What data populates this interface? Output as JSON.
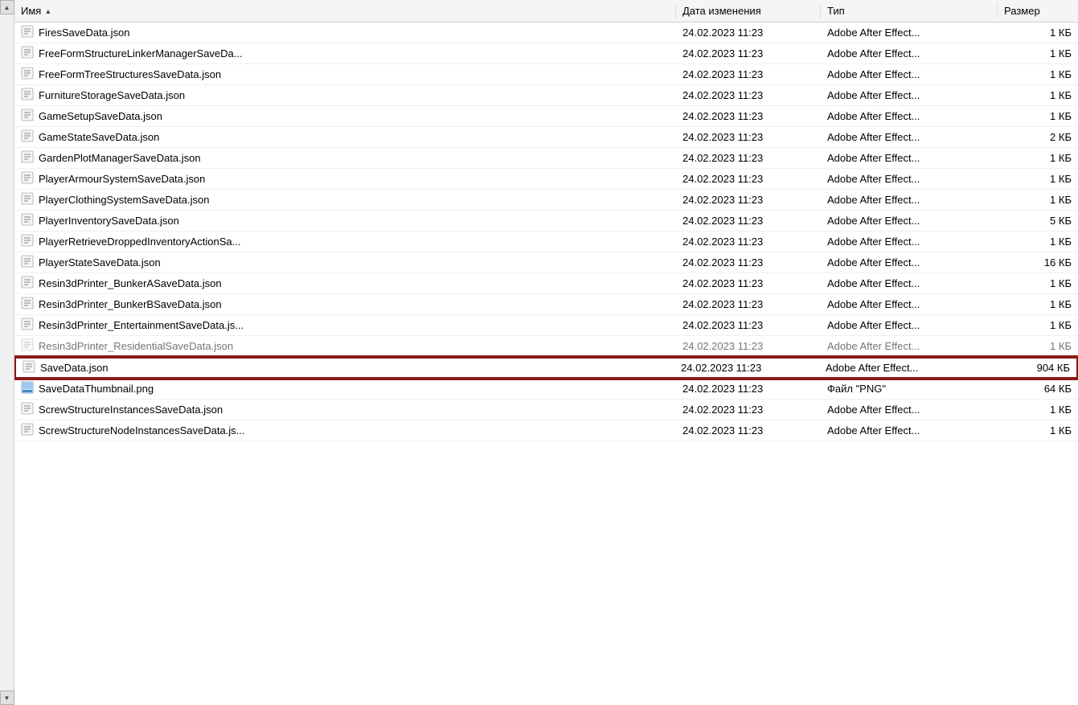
{
  "colors": {
    "selected_border": "#8b1a1a",
    "header_bg": "#f5f5f5",
    "row_hover": "#e8f0fe",
    "text": "#000000",
    "bg": "#ffffff"
  },
  "columns": [
    {
      "key": "name",
      "label": "Имя",
      "sort": "asc"
    },
    {
      "key": "date",
      "label": "Дата изменения",
      "sort": null
    },
    {
      "key": "type",
      "label": "Тип",
      "sort": null
    },
    {
      "key": "size",
      "label": "Размер",
      "sort": null
    }
  ],
  "files": [
    {
      "name": "FiresSaveData.json",
      "date": "24.02.2023 11:23",
      "type": "Adobe After Effect...",
      "size": "1 КБ",
      "icon": "json",
      "selected": false,
      "dimmed": false
    },
    {
      "name": "FreeFormStructureLinkerManagerSaveDa...",
      "date": "24.02.2023 11:23",
      "type": "Adobe After Effect...",
      "size": "1 КБ",
      "icon": "json",
      "selected": false,
      "dimmed": false
    },
    {
      "name": "FreeFormTreeStructuresSaveData.json",
      "date": "24.02.2023 11:23",
      "type": "Adobe After Effect...",
      "size": "1 КБ",
      "icon": "json",
      "selected": false,
      "dimmed": false
    },
    {
      "name": "FurnitureStorageSaveData.json",
      "date": "24.02.2023 11:23",
      "type": "Adobe After Effect...",
      "size": "1 КБ",
      "icon": "json",
      "selected": false,
      "dimmed": false
    },
    {
      "name": "GameSetupSaveData.json",
      "date": "24.02.2023 11:23",
      "type": "Adobe After Effect...",
      "size": "1 КБ",
      "icon": "json",
      "selected": false,
      "dimmed": false
    },
    {
      "name": "GameStateSaveData.json",
      "date": "24.02.2023 11:23",
      "type": "Adobe After Effect...",
      "size": "2 КБ",
      "icon": "json",
      "selected": false,
      "dimmed": false
    },
    {
      "name": "GardenPlotManagerSaveData.json",
      "date": "24.02.2023 11:23",
      "type": "Adobe After Effect...",
      "size": "1 КБ",
      "icon": "json",
      "selected": false,
      "dimmed": false
    },
    {
      "name": "PlayerArmourSystemSaveData.json",
      "date": "24.02.2023 11:23",
      "type": "Adobe After Effect...",
      "size": "1 КБ",
      "icon": "json",
      "selected": false,
      "dimmed": false
    },
    {
      "name": "PlayerClothingSystemSaveData.json",
      "date": "24.02.2023 11:23",
      "type": "Adobe After Effect...",
      "size": "1 КБ",
      "icon": "json",
      "selected": false,
      "dimmed": false
    },
    {
      "name": "PlayerInventorySaveData.json",
      "date": "24.02.2023 11:23",
      "type": "Adobe After Effect...",
      "size": "5 КБ",
      "icon": "json",
      "selected": false,
      "dimmed": false
    },
    {
      "name": "PlayerRetrieveDroppedInventoryActionSa...",
      "date": "24.02.2023 11:23",
      "type": "Adobe After Effect...",
      "size": "1 КБ",
      "icon": "json",
      "selected": false,
      "dimmed": false
    },
    {
      "name": "PlayerStateSaveData.json",
      "date": "24.02.2023 11:23",
      "type": "Adobe After Effect...",
      "size": "16 КБ",
      "icon": "json",
      "selected": false,
      "dimmed": false
    },
    {
      "name": "Resin3dPrinter_BunkerASaveData.json",
      "date": "24.02.2023 11:23",
      "type": "Adobe After Effect...",
      "size": "1 КБ",
      "icon": "json",
      "selected": false,
      "dimmed": false
    },
    {
      "name": "Resin3dPrinter_BunkerBSaveData.json",
      "date": "24.02.2023 11:23",
      "type": "Adobe After Effect...",
      "size": "1 КБ",
      "icon": "json",
      "selected": false,
      "dimmed": false
    },
    {
      "name": "Resin3dPrinter_EntertainmentSaveData.js...",
      "date": "24.02.2023 11:23",
      "type": "Adobe After Effect...",
      "size": "1 КБ",
      "icon": "json",
      "selected": false,
      "dimmed": false
    },
    {
      "name": "Resin3dPrinter_ResidentialSaveData.json",
      "date": "24.02.2023 11:23",
      "type": "Adobe After Effect...",
      "size": "1 КБ",
      "icon": "json",
      "selected": false,
      "dimmed": true
    },
    {
      "name": "SaveData.json",
      "date": "24.02.2023 11:23",
      "type": "Adobe After Effect...",
      "size": "904 КБ",
      "icon": "json",
      "selected": true,
      "dimmed": false
    },
    {
      "name": "SaveDataThumbnail.png",
      "date": "24.02.2023 11:23",
      "type": "Файл \"PNG\"",
      "size": "64 КБ",
      "icon": "png",
      "selected": false,
      "dimmed": false
    },
    {
      "name": "ScrewStructureInstancesSaveData.json",
      "date": "24.02.2023 11:23",
      "type": "Adobe After Effect...",
      "size": "1 КБ",
      "icon": "json",
      "selected": false,
      "dimmed": false
    },
    {
      "name": "ScrewStructureNodeInstancesSaveData.js...",
      "date": "24.02.2023 11:23",
      "type": "Adobe After Effect...",
      "size": "1 КБ",
      "icon": "json",
      "selected": false,
      "dimmed": false
    }
  ]
}
